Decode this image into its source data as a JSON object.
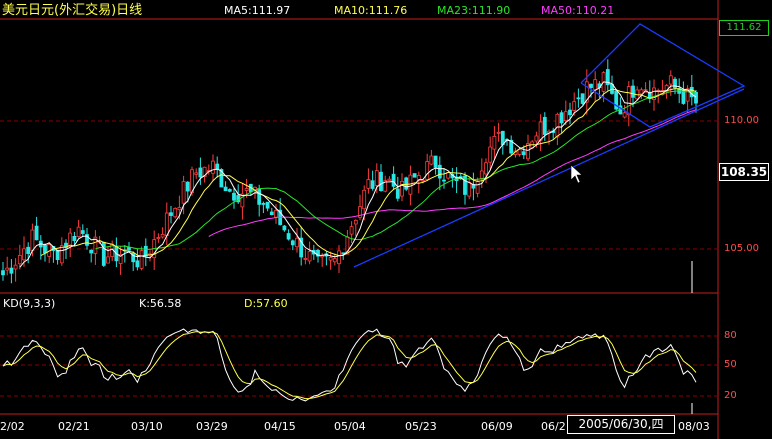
{
  "header": {
    "title": "美元日元(外汇交易)日线",
    "ma5": "MA5:111.97",
    "ma10": "MA10:111.76",
    "ma23": "MA23:111.90",
    "ma50": "MA50:110.21"
  },
  "price_axis": {
    "current": "108.35",
    "top_value": "111.62",
    "labels": [
      "110.00",
      "105.00"
    ]
  },
  "kd": {
    "name": "KD(9,3,3)",
    "k": "K:56.58",
    "d": "D:57.60",
    "labels": [
      "80",
      "50",
      "20"
    ]
  },
  "x_axis": {
    "labels": [
      "2/02",
      "02/21",
      "03/10",
      "03/29",
      "04/15",
      "05/04",
      "05/23",
      "06/09",
      "06/2",
      "08/03"
    ],
    "cursor_date": "2005/06/30,四"
  },
  "colors": {
    "up": "#ff3c3c",
    "down": "#28e6e6",
    "ma5": "#ffffff",
    "ma10": "#ffff4d",
    "ma23": "#29e329",
    "ma50": "#ff3cff",
    "trendline": "#1a3cff",
    "grid": "#8b0000"
  },
  "chart_data": {
    "type": "candlestick",
    "title": "美元日元(外汇交易)日线",
    "price_range": [
      103.5,
      112.2
    ],
    "gridlines": [
      110.0,
      105.0
    ],
    "series": [
      {
        "name": "MA5",
        "last": 111.97
      },
      {
        "name": "MA10",
        "last": 111.76
      },
      {
        "name": "MA23",
        "last": 111.9
      },
      {
        "name": "MA50",
        "last": 110.21
      }
    ],
    "close_path": [
      [
        0,
        104.0
      ],
      [
        7,
        105.4
      ],
      [
        12,
        104.8
      ],
      [
        18,
        105.8
      ],
      [
        24,
        104.7
      ],
      [
        29,
        104.9
      ],
      [
        33,
        104.5
      ],
      [
        37,
        105.6
      ],
      [
        42,
        107.0
      ],
      [
        46,
        108.0
      ],
      [
        50,
        108.2
      ],
      [
        54,
        107.3
      ],
      [
        58,
        107.2
      ],
      [
        62,
        106.8
      ],
      [
        66,
        106.0
      ],
      [
        70,
        105.2
      ],
      [
        75,
        104.3
      ],
      [
        79,
        104.5
      ],
      [
        83,
        106.0
      ],
      [
        87,
        107.5
      ],
      [
        91,
        107.8
      ],
      [
        95,
        107.2
      ],
      [
        99,
        107.9
      ],
      [
        103,
        108.4
      ],
      [
        107,
        107.6
      ],
      [
        111,
        107.3
      ],
      [
        115,
        108.8
      ],
      [
        119,
        109.4
      ],
      [
        123,
        108.9
      ],
      [
        127,
        109.6
      ],
      [
        131,
        110.0
      ],
      [
        135,
        110.6
      ],
      [
        139,
        111.3
      ],
      [
        143,
        111.5
      ],
      [
        147,
        110.4
      ],
      [
        151,
        111.6
      ],
      [
        155,
        111.2
      ],
      [
        159,
        111.4
      ],
      [
        163,
        110.9
      ],
      [
        165,
        110.7
      ]
    ],
    "kd_levels": [
      80,
      50,
      20
    ],
    "k_last": 56.58,
    "d_last": 57.6
  }
}
